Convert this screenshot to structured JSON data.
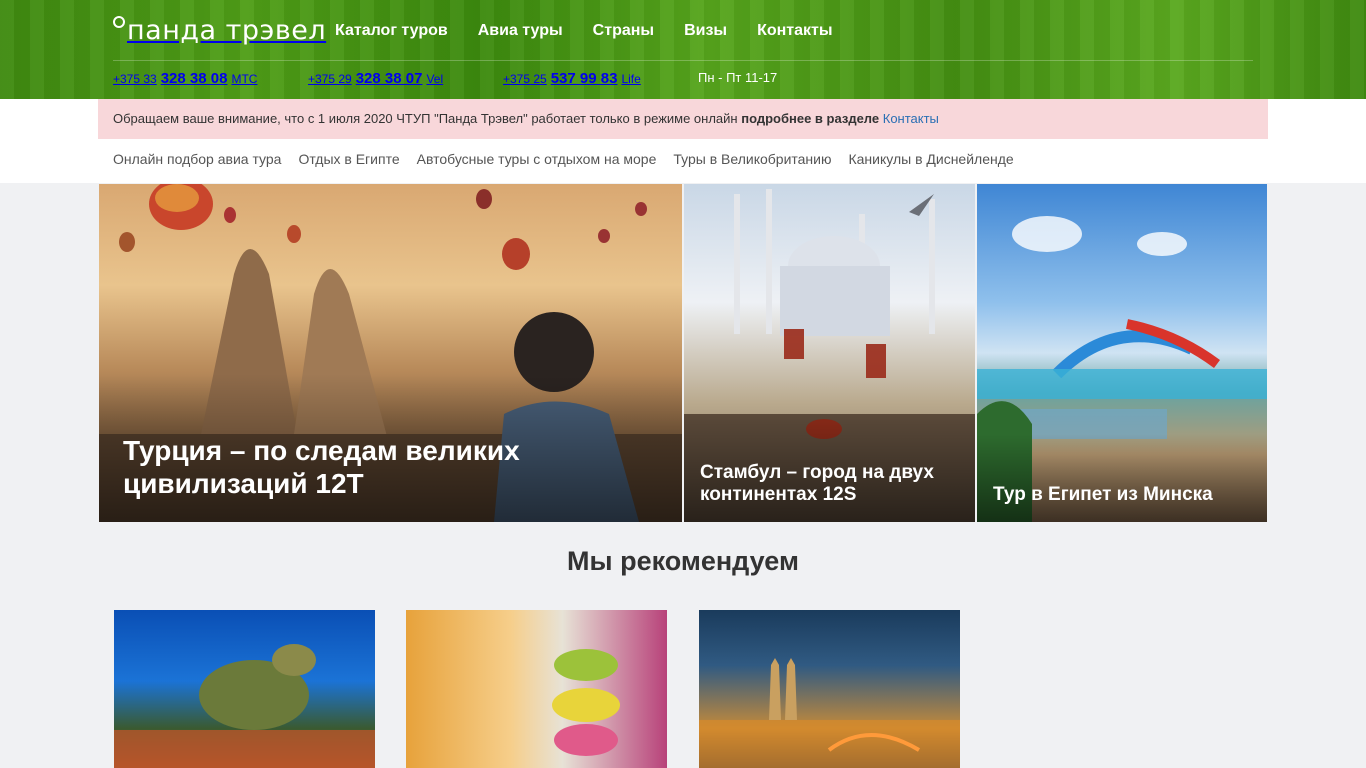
{
  "brand": {
    "name": "панда трэвел"
  },
  "nav": {
    "items": [
      "Каталог туров",
      "Авиа туры",
      "Страны",
      "Визы",
      "Контакты"
    ]
  },
  "phones": [
    {
      "code": "+375 33",
      "number": "328 38 08",
      "operator": "МТС"
    },
    {
      "code": "+375 29",
      "number": "328 38 07",
      "operator": "Vel"
    },
    {
      "code": "+375 25",
      "number": "537 99 83",
      "operator": "Life"
    }
  ],
  "hours": "Пн - Пт 11-17",
  "notice": {
    "text": "Обращаем ваше внимание, что с 1 июля 2020 ЧТУП \"Панда Трэвел\" работает только в режиме онлайн ",
    "bold": "подробнее в разделе",
    "link": "Контакты"
  },
  "subnav": [
    "Онлайн подбор авиа тура",
    "Отдых в Египте",
    "Автобусные туры с отдыхом на море",
    "Туры в Великобританию",
    "Каникулы в Диснейленде"
  ],
  "banners": [
    {
      "title": "Турция – по следам великих цивилизаций 12Т"
    },
    {
      "title": "Стамбул – город на двух континентах 12S"
    },
    {
      "title": "Тур в Египет из Минска"
    }
  ],
  "recommend": {
    "title": "Мы рекомендуем"
  },
  "colors": {
    "header_green": "#4a9614",
    "notice_bg": "#f8d7da",
    "link": "#2a6fb4"
  }
}
